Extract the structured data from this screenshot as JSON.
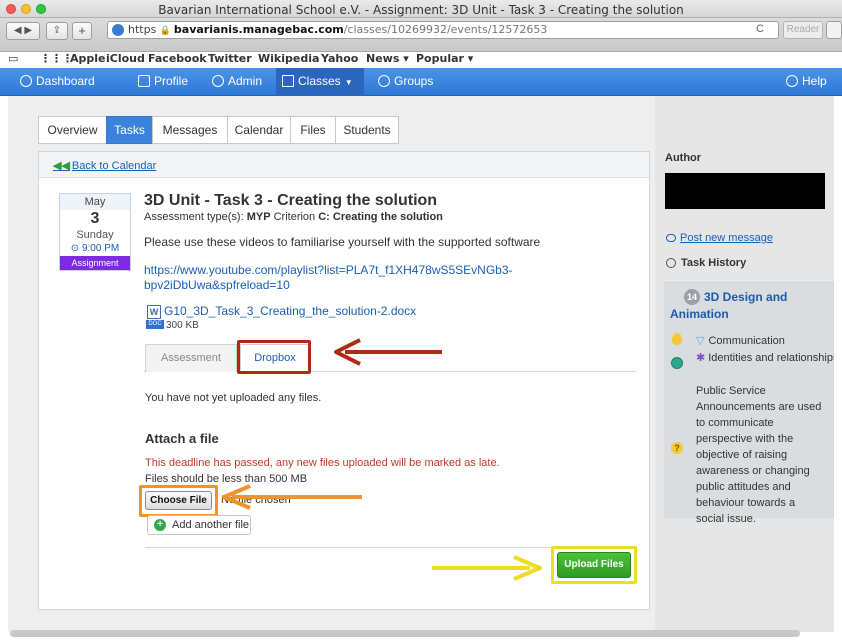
{
  "browser": {
    "window_title": "Bavarian International School e.V. - Assignment: 3D Unit - Task 3 - Creating the solution",
    "url_scheme": "https",
    "url_host": "bavarianis.managebac.com",
    "url_path": "/classes/10269932/events/12572653",
    "reload_icon": "C",
    "reader_label": "Reader",
    "bookmarks": [
      "Apple",
      "iCloud",
      "Facebook",
      "Twitter",
      "Wikipedia",
      "Yahoo",
      "News ▾",
      "Popular ▾"
    ]
  },
  "nav": {
    "items": [
      "Dashboard",
      "Profile",
      "Admin",
      "Classes",
      "Groups"
    ],
    "help": "Help"
  },
  "tabs": [
    "Overview",
    "Tasks",
    "Messages",
    "Calendar",
    "Files",
    "Students"
  ],
  "card": {
    "back_link": "Back to Calendar",
    "date": {
      "month": "May",
      "day": "3",
      "weekday": "Sunday",
      "time": "⊙ 9:00 PM",
      "type": "Assignment"
    },
    "title": "3D Unit - Task 3 - Creating the solution",
    "assessment_prefix": "Assessment type(s): ",
    "assessment_myp": "MYP",
    "assessment_criterion": " Criterion ",
    "assessment_c": "C: Creating the solution",
    "description": "Please use these videos to familiarise yourself with the supported software",
    "link": "https://www.youtube.com/playlist?list=PLA7t_f1XH478wS5SEvNGb3-bpv2iDbUwa&spfreload=10",
    "file": {
      "icon_letter": "W",
      "icon_tag": "DOC",
      "name": "G10_3D_Task_3_Creating_the_solution-2.docx",
      "size": "300 KB"
    },
    "subtabs": [
      "Assessment",
      "Dropbox"
    ],
    "no_files": "You have not yet uploaded any files.",
    "attach_heading": "Attach a file",
    "deadline_warning": "This deadline has passed, any new files uploaded will be marked as late.",
    "size_note": "Files should be less than 500 MB",
    "choose_file": "Choose File",
    "no_file_chosen": "No file chosen",
    "add_another": "Add another file",
    "upload": "Upload Files"
  },
  "sidebar": {
    "author_label": "Author",
    "post_message": "Post new message",
    "task_history": "Task History",
    "unit_badge": "14",
    "unit_title": "3D Design and Animation",
    "concept_communication": "Communication",
    "concept_identities": "Identities and relationships",
    "statement": "Public Service Announcements are used to communicate perspective with the objective of raising awareness or changing public attitudes and behaviour towards a social issue."
  },
  "colors": {
    "nav_blue": "#2f77d6",
    "annotation_red": "#b02a12",
    "annotation_orange": "#f0932b",
    "annotation_yellow": "#eede22",
    "upload_green": "#2e9a24",
    "assignment_purple": "#7b2be0"
  }
}
